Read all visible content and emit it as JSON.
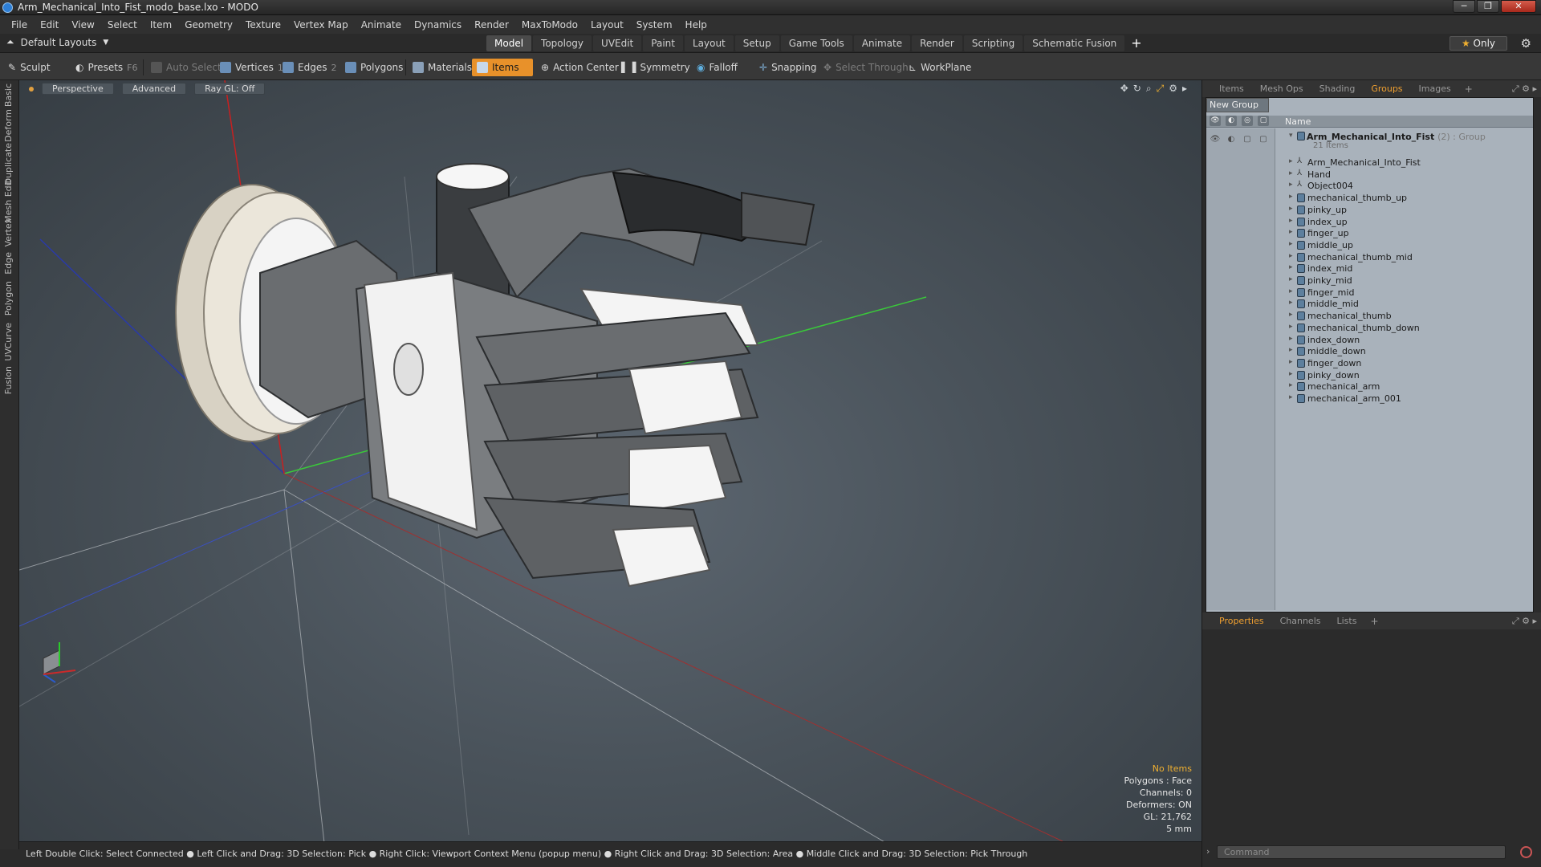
{
  "window": {
    "title": "Arm_Mechanical_Into_Fist_modo_base.lxo - MODO",
    "controls": [
      "─",
      "❐",
      "✕"
    ]
  },
  "menu": [
    "File",
    "Edit",
    "View",
    "Select",
    "Item",
    "Geometry",
    "Texture",
    "Vertex Map",
    "Animate",
    "Dynamics",
    "Render",
    "MaxToModo",
    "Layout",
    "System",
    "Help"
  ],
  "layout": {
    "dropdown": "Default Layouts",
    "tabs": [
      "Model",
      "Topology",
      "UVEdit",
      "Paint",
      "Layout",
      "Setup",
      "Game Tools",
      "Animate",
      "Render",
      "Scripting",
      "Schematic Fusion"
    ],
    "active_tab": "Model",
    "only_label": "Only"
  },
  "toolbar": {
    "sculpt": "Sculpt",
    "presets": "Presets",
    "presets_key": "F6",
    "auto_select": "Auto Select",
    "vertices": "Vertices",
    "vertices_key": "1",
    "edges": "Edges",
    "edges_key": "2",
    "polygons": "Polygons",
    "materials": "Materials",
    "items": "Items",
    "action_center": "Action Center",
    "symmetry": "Symmetry",
    "falloff": "Falloff",
    "snapping": "Snapping",
    "select_through": "Select Through",
    "workplane": "WorkPlane"
  },
  "left_tabs": [
    "Basic",
    "Deform",
    "Duplicate",
    "Mesh Edit",
    "Vertex",
    "Edge",
    "Polygon",
    "Curve",
    "UV",
    "Fusion"
  ],
  "viewport": {
    "view_mode": "Perspective",
    "shading": "Advanced",
    "raygl": "Ray GL: Off",
    "info": {
      "selection": "No Items",
      "polygons": "Polygons : Face",
      "channels": "Channels: 0",
      "deformers": "Deformers: ON",
      "gl": "GL: 21,762",
      "scale": "5 mm"
    }
  },
  "status": "Left Double Click: Select Connected ● Left Click and Drag: 3D Selection: Pick ● Right Click: Viewport Context Menu (popup menu) ● Right Click and Drag: 3D Selection: Area ● Middle Click and Drag: 3D Selection: Pick Through",
  "right_panel": {
    "top_tabs": [
      "Items",
      "Mesh Ops",
      "Shading",
      "Groups",
      "Images"
    ],
    "top_active": "Groups",
    "new_group": "New Group",
    "name_header": "Name",
    "group": {
      "name": "Arm_Mechanical_Into_Fist",
      "extra": "(2) : Group",
      "count": "21 Items"
    },
    "items": [
      {
        "name": "Arm_Mechanical_Into_Fist",
        "type": "locator"
      },
      {
        "name": "Hand",
        "type": "locator"
      },
      {
        "name": "Object004",
        "type": "locator"
      },
      {
        "name": "mechanical_thumb_up",
        "type": "mesh"
      },
      {
        "name": "pinky_up",
        "type": "mesh"
      },
      {
        "name": "index_up",
        "type": "mesh"
      },
      {
        "name": "finger_up",
        "type": "mesh"
      },
      {
        "name": "middle_up",
        "type": "mesh"
      },
      {
        "name": "mechanical_thumb_mid",
        "type": "mesh"
      },
      {
        "name": "index_mid",
        "type": "mesh"
      },
      {
        "name": "pinky_mid",
        "type": "mesh"
      },
      {
        "name": "finger_mid",
        "type": "mesh"
      },
      {
        "name": "middle_mid",
        "type": "mesh"
      },
      {
        "name": "mechanical_thumb",
        "type": "mesh"
      },
      {
        "name": "mechanical_thumb_down",
        "type": "mesh"
      },
      {
        "name": "index_down",
        "type": "mesh"
      },
      {
        "name": "middle_down",
        "type": "mesh"
      },
      {
        "name": "finger_down",
        "type": "mesh"
      },
      {
        "name": "pinky_down",
        "type": "mesh"
      },
      {
        "name": "mechanical_arm",
        "type": "mesh"
      },
      {
        "name": "mechanical_arm_001",
        "type": "mesh"
      }
    ],
    "bottom_tabs": [
      "Properties",
      "Channels",
      "Lists"
    ],
    "bottom_active": "Properties",
    "command_placeholder": "Command"
  },
  "colors": {
    "accent": "#e8912a",
    "active_tab_text": "#f0a030",
    "viewport_bg": "#4a535b",
    "groups_bg": "#a9b2bb"
  }
}
